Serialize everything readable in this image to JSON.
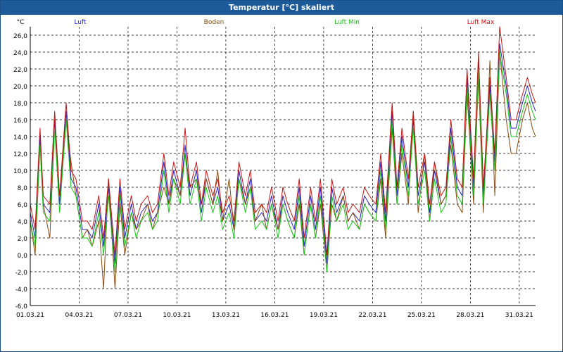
{
  "window": {
    "title": "Temperatur [°C] skaliert"
  },
  "chart_data": {
    "type": "line",
    "title": "Temperatur [°C] skaliert",
    "ylabel": "°C",
    "xlabel": "",
    "ylim": [
      -6,
      27
    ],
    "xlim": [
      0,
      31
    ],
    "grid": true,
    "legend": "top",
    "y_ticks": [
      "-6,0",
      "-4,0",
      "-2,0",
      "0,0",
      "2,0",
      "4,0",
      "6,0",
      "8,0",
      "10,0",
      "12,0",
      "14,0",
      "16,0",
      "18,0",
      "20,0",
      "22,0",
      "24,0",
      "26,0"
    ],
    "x_tick_labels": [
      "01.03.21",
      "04.03.21",
      "07.03.21",
      "10.03.21",
      "13.03.21",
      "16.03.21",
      "19.03.21",
      "22.03.21",
      "25.03.21",
      "28.03.21",
      "31.03.21"
    ],
    "x_tick_days": [
      0,
      3,
      6,
      9,
      12,
      15,
      18,
      21,
      24,
      27,
      30
    ],
    "series": [
      {
        "name": "Luft",
        "color": "#2323c8",
        "x": [
          0,
          0.3,
          0.6,
          0.8,
          1.2,
          1.5,
          1.8,
          2.2,
          2.5,
          2.8,
          3.2,
          3.5,
          3.8,
          4.2,
          4.5,
          4.8,
          5.2,
          5.5,
          5.8,
          6.2,
          6.5,
          6.8,
          7.2,
          7.5,
          7.8,
          8.2,
          8.5,
          8.8,
          9.2,
          9.5,
          9.8,
          10.2,
          10.5,
          10.8,
          11.2,
          11.5,
          11.8,
          12.2,
          12.5,
          12.8,
          13.2,
          13.5,
          13.8,
          14.2,
          14.5,
          14.8,
          15.2,
          15.5,
          15.8,
          16.2,
          16.5,
          16.8,
          17.2,
          17.5,
          17.8,
          18.2,
          18.5,
          18.8,
          19.2,
          19.5,
          19.8,
          20.2,
          20.5,
          20.8,
          21.2,
          21.5,
          21.8,
          22.2,
          22.5,
          22.8,
          23.2,
          23.5,
          23.8,
          24.2,
          24.5,
          24.8,
          25.2,
          25.5,
          25.8,
          26.2,
          26.5,
          26.8,
          27.2,
          27.5,
          27.8,
          28.2,
          28.5,
          28.8,
          29.2,
          29.5,
          29.8,
          30.2,
          30.5,
          30.8,
          31
        ],
        "y": [
          5,
          2,
          14,
          6,
          5,
          16,
          6,
          17,
          9,
          8,
          3,
          3,
          2,
          6,
          1,
          8,
          -1,
          8,
          2,
          6,
          3,
          5,
          6,
          4,
          5,
          11,
          6,
          10,
          7,
          13,
          7,
          10,
          5,
          9,
          6,
          8,
          4,
          6,
          3,
          10,
          6,
          9,
          4,
          5,
          4,
          7,
          3,
          7,
          5,
          3,
          8,
          1,
          7,
          3,
          8,
          -1,
          8,
          5,
          7,
          4,
          5,
          4,
          7,
          6,
          5,
          11,
          4,
          17,
          7,
          14,
          8,
          16,
          7,
          11,
          5,
          10,
          6,
          7,
          15,
          8,
          7,
          21,
          8,
          23,
          7,
          20,
          11,
          25,
          20,
          15,
          15,
          18,
          20,
          18,
          17
        ],
        "values_note": ""
      },
      {
        "name": "Boden",
        "color": "#8b4a0e",
        "x": [
          0,
          0.3,
          0.6,
          0.8,
          1.2,
          1.5,
          1.8,
          2.2,
          2.5,
          2.8,
          3.2,
          3.5,
          3.8,
          4.2,
          4.5,
          4.8,
          5.2,
          5.5,
          5.8,
          6.2,
          6.5,
          6.8,
          7.2,
          7.5,
          7.8,
          8.2,
          8.5,
          8.8,
          9.2,
          9.5,
          9.8,
          10.2,
          10.5,
          10.8,
          11.2,
          11.5,
          11.8,
          12.2,
          12.5,
          12.8,
          13.2,
          13.5,
          13.8,
          14.2,
          14.5,
          14.8,
          15.2,
          15.5,
          15.8,
          16.2,
          16.5,
          16.8,
          17.2,
          17.5,
          17.8,
          18.2,
          18.5,
          18.8,
          19.2,
          19.5,
          19.8,
          20.2,
          20.5,
          20.8,
          21.2,
          21.5,
          21.8,
          22.2,
          22.5,
          22.8,
          23.2,
          23.5,
          23.8,
          24.2,
          24.5,
          24.8,
          25.2,
          25.5,
          25.8,
          26.2,
          26.5,
          26.8,
          27.2,
          27.5,
          27.8,
          28.2,
          28.5,
          28.8,
          29.2,
          29.5,
          29.8,
          30.2,
          30.5,
          30.8,
          31
        ],
        "y": [
          4,
          0,
          13,
          6,
          2,
          15,
          7,
          16,
          11,
          7,
          2,
          3,
          1,
          4,
          -4,
          9,
          -4,
          6,
          0,
          5,
          3,
          4,
          6,
          3,
          5,
          8,
          6,
          9,
          7,
          12,
          8,
          9,
          6,
          9,
          6,
          10,
          4,
          9,
          3,
          9,
          6,
          8,
          4,
          6,
          3,
          6,
          3,
          6,
          4,
          2,
          6,
          0,
          6,
          2,
          6,
          -2,
          6,
          4,
          7,
          4,
          5,
          3,
          6,
          5,
          4,
          9,
          2,
          15,
          6,
          12,
          6,
          17,
          5,
          12,
          4,
          11,
          6,
          7,
          13,
          6,
          5,
          19,
          6,
          21,
          5,
          23,
          7,
          24,
          16,
          12,
          12,
          16,
          18,
          15,
          14
        ],
        "values_note": ""
      },
      {
        "name": "Luft Min",
        "color": "#14c814",
        "x": [
          0,
          0.3,
          0.6,
          0.8,
          1.2,
          1.5,
          1.8,
          2.2,
          2.5,
          2.8,
          3.2,
          3.5,
          3.8,
          4.2,
          4.5,
          4.8,
          5.2,
          5.5,
          5.8,
          6.2,
          6.5,
          6.8,
          7.2,
          7.5,
          7.8,
          8.2,
          8.5,
          8.8,
          9.2,
          9.5,
          9.8,
          10.2,
          10.5,
          10.8,
          11.2,
          11.5,
          11.8,
          12.2,
          12.5,
          12.8,
          13.2,
          13.5,
          13.8,
          14.2,
          14.5,
          14.8,
          15.2,
          15.5,
          15.8,
          16.2,
          16.5,
          16.8,
          17.2,
          17.5,
          17.8,
          18.2,
          18.5,
          18.8,
          19.2,
          19.5,
          19.8,
          20.2,
          20.5,
          20.8,
          21.2,
          21.5,
          21.8,
          22.2,
          22.5,
          22.8,
          23.2,
          23.5,
          23.8,
          24.2,
          24.5,
          24.8,
          25.2,
          25.5,
          25.8,
          26.2,
          26.5,
          26.8,
          27.2,
          27.5,
          27.8,
          28.2,
          28.5,
          28.8,
          29.2,
          29.5,
          29.8,
          30.2,
          30.5,
          30.8,
          31
        ],
        "y": [
          4,
          1,
          13,
          5,
          4,
          15,
          5,
          16,
          8,
          7,
          2,
          2,
          1,
          5,
          0,
          7,
          -2,
          7,
          1,
          5,
          2,
          4,
          5,
          3,
          4,
          10,
          5,
          9,
          6,
          12,
          6,
          9,
          4,
          8,
          5,
          7,
          3,
          5,
          2,
          9,
          5,
          8,
          3,
          4,
          3,
          6,
          2,
          6,
          4,
          2,
          7,
          0,
          6,
          2,
          7,
          -2,
          7,
          4,
          6,
          3,
          4,
          3,
          6,
          5,
          4,
          10,
          3,
          16,
          6,
          13,
          7,
          15,
          6,
          10,
          4,
          9,
          5,
          6,
          14,
          7,
          6,
          20,
          7,
          22,
          6,
          19,
          10,
          24,
          19,
          14,
          14,
          17,
          19,
          17,
          16
        ],
        "values_note": ""
      },
      {
        "name": "Luft Max",
        "color": "#c81414",
        "x": [
          0,
          0.3,
          0.6,
          0.8,
          1.2,
          1.5,
          1.8,
          2.2,
          2.5,
          2.8,
          3.2,
          3.5,
          3.8,
          4.2,
          4.5,
          4.8,
          5.2,
          5.5,
          5.8,
          6.2,
          6.5,
          6.8,
          7.2,
          7.5,
          7.8,
          8.2,
          8.5,
          8.8,
          9.2,
          9.5,
          9.8,
          10.2,
          10.5,
          10.8,
          11.2,
          11.5,
          11.8,
          12.2,
          12.5,
          12.8,
          13.2,
          13.5,
          13.8,
          14.2,
          14.5,
          14.8,
          15.2,
          15.5,
          15.8,
          16.2,
          16.5,
          16.8,
          17.2,
          17.5,
          17.8,
          18.2,
          18.5,
          18.8,
          19.2,
          19.5,
          19.8,
          20.2,
          20.5,
          20.8,
          21.2,
          21.5,
          21.8,
          22.2,
          22.5,
          22.8,
          23.2,
          23.5,
          23.8,
          24.2,
          24.5,
          24.8,
          25.2,
          25.5,
          25.8,
          26.2,
          26.5,
          26.8,
          27.2,
          27.5,
          27.8,
          28.2,
          28.5,
          28.8,
          29.2,
          29.5,
          29.8,
          30.2,
          30.5,
          30.8,
          31
        ],
        "y": [
          6,
          3,
          15,
          7,
          6,
          17,
          7,
          18,
          10,
          9,
          4,
          4,
          3,
          7,
          2,
          9,
          0,
          9,
          3,
          7,
          4,
          6,
          7,
          5,
          6,
          12,
          7,
          11,
          8,
          15,
          8,
          11,
          6,
          10,
          7,
          9,
          5,
          7,
          4,
          11,
          7,
          10,
          5,
          6,
          5,
          8,
          4,
          8,
          6,
          4,
          9,
          2,
          8,
          4,
          9,
          0,
          9,
          6,
          8,
          5,
          6,
          5,
          8,
          7,
          6,
          12,
          5,
          18,
          8,
          15,
          9,
          17,
          8,
          12,
          6,
          11,
          7,
          8,
          16,
          9,
          8,
          22,
          9,
          24,
          8,
          21,
          12,
          27,
          21,
          16,
          16,
          19,
          21,
          19,
          18
        ],
        "values_note": ""
      }
    ]
  }
}
